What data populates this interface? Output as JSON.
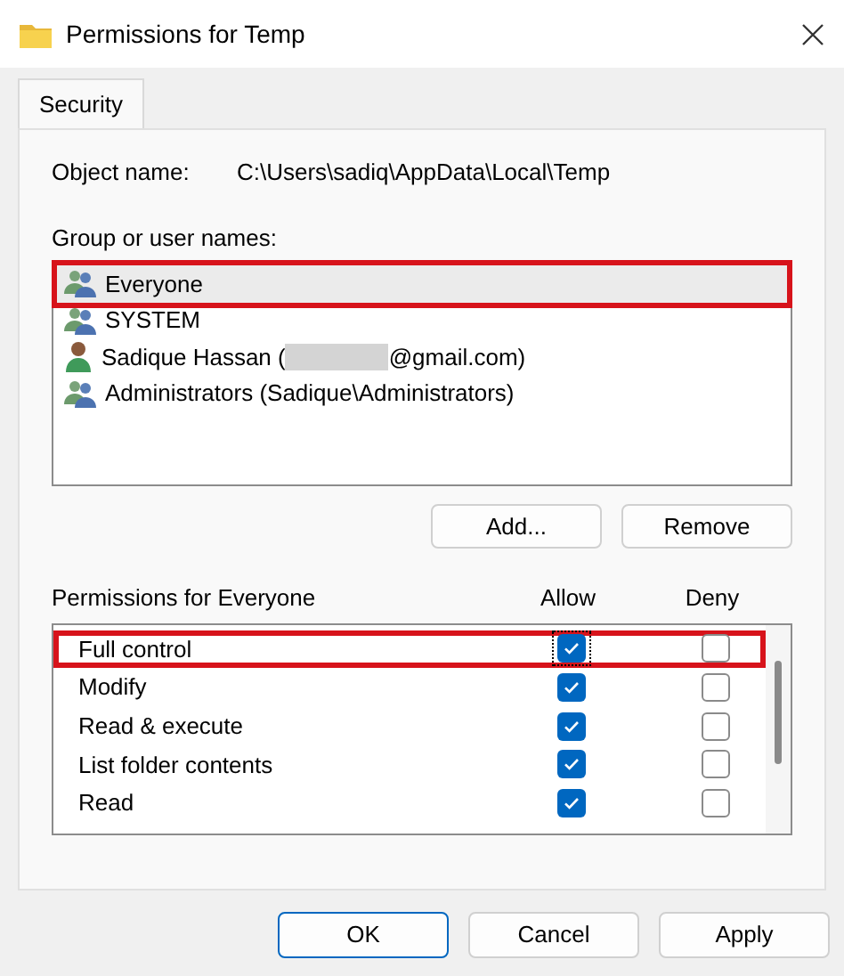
{
  "window": {
    "title": "Permissions for Temp"
  },
  "tabs": [
    {
      "label": "Security",
      "selected": true
    }
  ],
  "object_name": {
    "label": "Object name:",
    "value": "C:\\Users\\sadiq\\AppData\\Local\\Temp"
  },
  "groups": {
    "label": "Group or user names:",
    "items": [
      {
        "kind": "group",
        "name": "Everyone",
        "selected": true,
        "highlighted": true
      },
      {
        "kind": "group",
        "name": "SYSTEM",
        "selected": false,
        "highlighted": false
      },
      {
        "kind": "user",
        "name": "Sadique Hassan (",
        "redacted": true,
        "name_end": "@gmail.com)",
        "selected": false,
        "highlighted": false
      },
      {
        "kind": "group",
        "name": "Administrators (Sadique\\Administrators)",
        "selected": false,
        "highlighted": false
      }
    ]
  },
  "group_buttons": [
    "Add...",
    "Remove"
  ],
  "permissions": {
    "label": "Permissions for Everyone",
    "allow_label": "Allow",
    "deny_label": "Deny",
    "rows": [
      {
        "name": "Full control",
        "allow": true,
        "deny": false,
        "focused": true,
        "highlighted": true
      },
      {
        "name": "Modify",
        "allow": true,
        "deny": false,
        "focused": false,
        "highlighted": false
      },
      {
        "name": "Read & execute",
        "allow": true,
        "deny": false,
        "focused": false,
        "highlighted": false
      },
      {
        "name": "List folder contents",
        "allow": true,
        "deny": false,
        "focused": false,
        "highlighted": false
      },
      {
        "name": "Read",
        "allow": true,
        "deny": false,
        "focused": false,
        "highlighted": false
      }
    ]
  },
  "dialog_buttons": [
    {
      "label": "OK",
      "default": true
    },
    {
      "label": "Cancel",
      "default": false
    },
    {
      "label": "Apply",
      "default": false
    }
  ]
}
